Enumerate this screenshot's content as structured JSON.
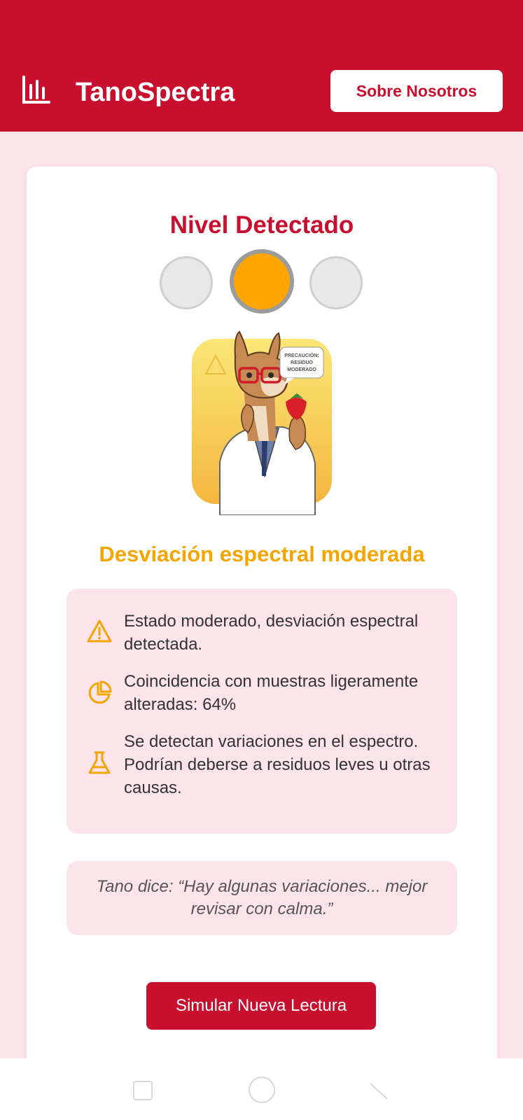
{
  "header": {
    "app_title": "TanoSpectra",
    "about_label": "Sobre Nosotros",
    "logo_icon": "bar-chart-icon",
    "background_color": "#c8102e"
  },
  "card": {
    "title": "Nivel Detectado",
    "traffic_light": {
      "active_index": 1,
      "active_color": "#ffa500",
      "inactive_color": "#e8e8e8"
    },
    "mascot": {
      "bubble_text": "PRECAUCIÓN: RESIDUO MODERADO"
    },
    "status_title": "Desviación espectral moderada",
    "status_color": "#f5a500",
    "info_items": [
      {
        "icon": "warning-icon",
        "text": "Estado moderado, desviación espectral detectada."
      },
      {
        "icon": "pie-chart-icon",
        "text": "Coincidencia con muestras ligeramente alteradas: 64%"
      },
      {
        "icon": "flask-icon",
        "text": "Se detectan variaciones en el espectro. Podrían deberse a residuos leves u otras causas."
      }
    ],
    "quote": "Tano dice: “Hay algunas variaciones... mejor revisar con calma.”",
    "simulate_label": "Simular Nueva Lectura"
  },
  "navbar": {
    "items": [
      "recents-icon",
      "home-icon",
      "back-icon"
    ]
  }
}
